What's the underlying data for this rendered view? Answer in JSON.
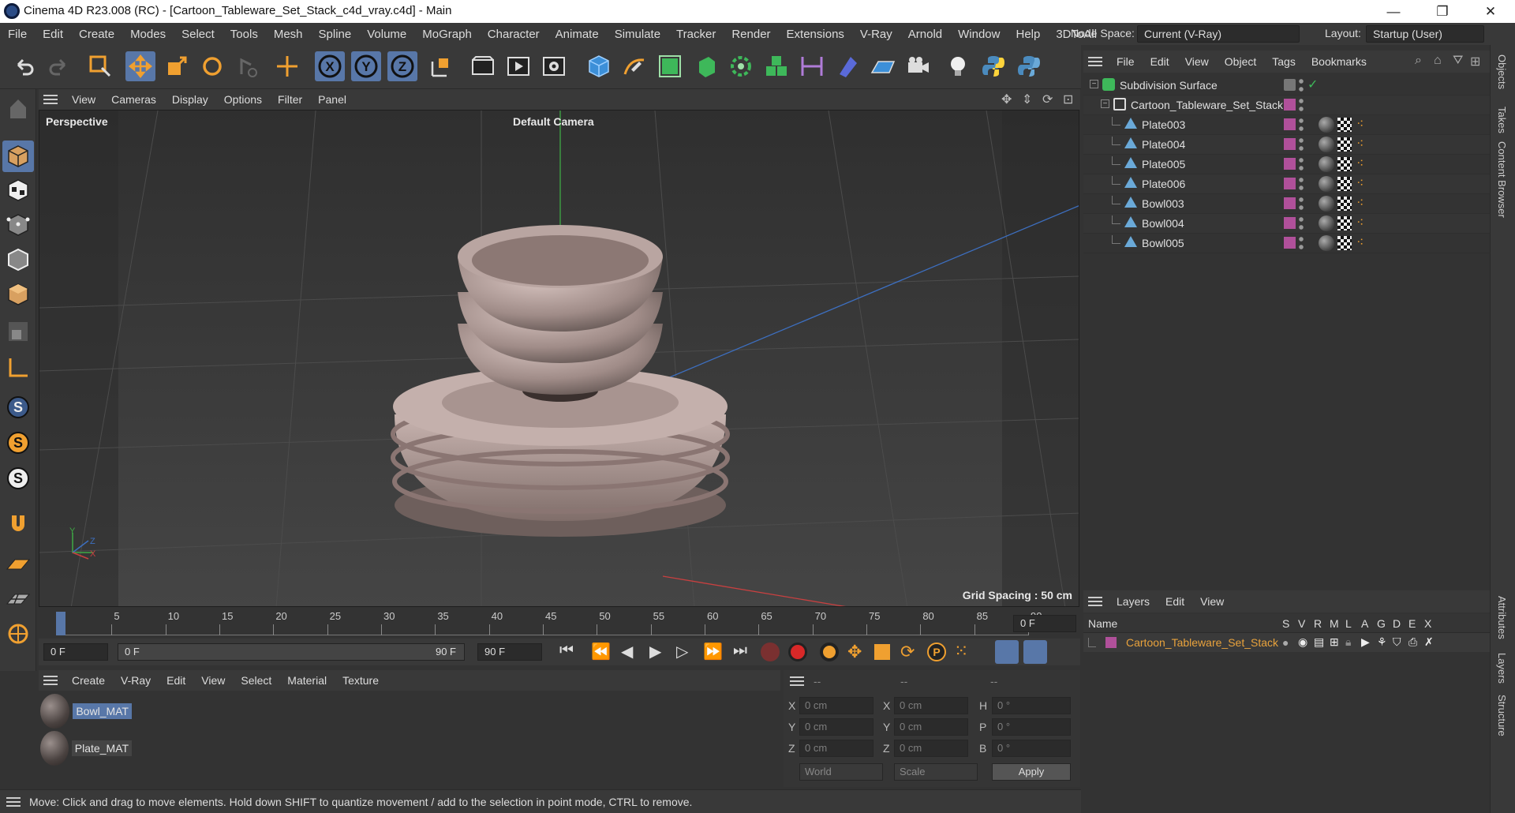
{
  "window": {
    "title": "Cinema 4D R23.008 (RC) - [Cartoon_Tableware_Set_Stack_c4d_vray.c4d] - Main",
    "minimize": "—",
    "maximize": "❐",
    "close": "✕"
  },
  "menubar": {
    "items": [
      "File",
      "Edit",
      "Create",
      "Modes",
      "Select",
      "Tools",
      "Mesh",
      "Spline",
      "Volume",
      "MoGraph",
      "Character",
      "Animate",
      "Simulate",
      "Tracker",
      "Render",
      "Extensions",
      "V-Ray",
      "Arnold",
      "Window",
      "Help",
      "3DToAll"
    ],
    "node_space_label": "Node Space:",
    "node_space_value": "Current (V-Ray)",
    "layout_label": "Layout:",
    "layout_value": "Startup (User)"
  },
  "viewport": {
    "menu": [
      "View",
      "Cameras",
      "Display",
      "Options",
      "Filter",
      "Panel"
    ],
    "label": "Perspective",
    "camera": "Default Camera",
    "grid_spacing": "Grid Spacing : 50 cm",
    "axis_y": "Y",
    "axis_z": "Z",
    "axis_x": "X"
  },
  "timeline": {
    "ticks": [
      "0",
      "5",
      "10",
      "15",
      "20",
      "25",
      "30",
      "35",
      "40",
      "45",
      "50",
      "55",
      "60",
      "65",
      "70",
      "75",
      "80",
      "85",
      "90"
    ],
    "current_frame": "0 F"
  },
  "playbar": {
    "start": "0 F",
    "range_start": "0 F",
    "range_end": "90 F",
    "end": "90 F"
  },
  "material_manager": {
    "menu": [
      "Create",
      "V-Ray",
      "Edit",
      "View",
      "Select",
      "Material",
      "Texture"
    ],
    "materials": [
      "Bowl_MAT",
      "Plate_MAT"
    ]
  },
  "coordinates": {
    "headers": [
      "--",
      "--",
      "--"
    ],
    "rows": [
      {
        "l1": "X",
        "v1": "0 cm",
        "l2": "X",
        "v2": "0 cm",
        "l3": "H",
        "v3": "0 °"
      },
      {
        "l1": "Y",
        "v1": "0 cm",
        "l2": "Y",
        "v2": "0 cm",
        "l3": "P",
        "v3": "0 °"
      },
      {
        "l1": "Z",
        "v1": "0 cm",
        "l2": "Z",
        "v2": "0 cm",
        "l3": "B",
        "v3": "0 °"
      }
    ],
    "space": "World",
    "mode": "Scale",
    "apply": "Apply"
  },
  "object_manager": {
    "menu": [
      "File",
      "Edit",
      "View",
      "Object",
      "Tags",
      "Bookmarks"
    ],
    "objects": [
      {
        "name": "Subdivision Surface",
        "level": 0
      },
      {
        "name": "Cartoon_Tableware_Set_Stack",
        "level": 1
      },
      {
        "name": "Plate003",
        "level": 2
      },
      {
        "name": "Plate004",
        "level": 2
      },
      {
        "name": "Plate005",
        "level": 2
      },
      {
        "name": "Plate006",
        "level": 2
      },
      {
        "name": "Bowl003",
        "level": 2
      },
      {
        "name": "Bowl004",
        "level": 2
      },
      {
        "name": "Bowl005",
        "level": 2
      }
    ]
  },
  "layer_manager": {
    "menu": [
      "Layers",
      "Edit",
      "View"
    ],
    "columns": [
      "Name",
      "S",
      "V",
      "R",
      "M",
      "L",
      "A",
      "G",
      "D",
      "E",
      "X"
    ],
    "layers": [
      "Cartoon_Tableware_Set_Stack"
    ],
    "layer_color": "#b0509a"
  },
  "right_tabs": [
    "Objects",
    "Takes",
    "Content Browser",
    "Attributes",
    "Layers",
    "Structure"
  ],
  "status": "Move: Click and drag to move elements. Hold down SHIFT to quantize movement / add to the selection in point mode, CTRL to remove.",
  "colors": {
    "accent": "#5877a8",
    "layer_text": "#e8a23c",
    "axis_x": "#c84040",
    "axis_y": "#3fa845",
    "axis_z": "#3d6fc0"
  }
}
